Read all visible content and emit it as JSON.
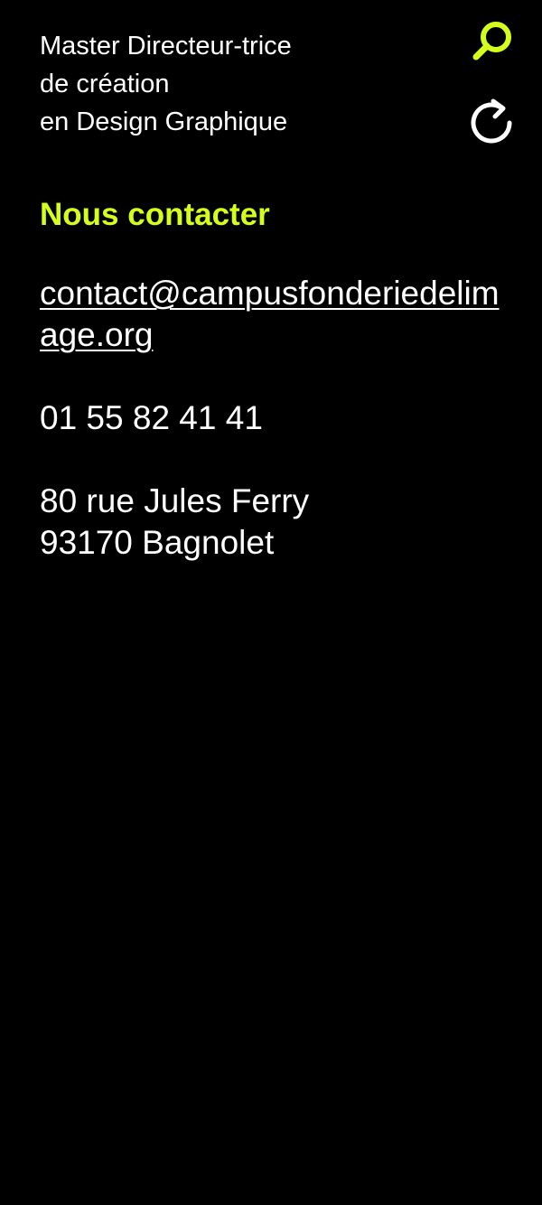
{
  "colors": {
    "background": "#000000",
    "text": "#ffffff",
    "accent": "#d4ff1a"
  },
  "header": {
    "title_lines": [
      "Master Directeur-trice",
      "de création",
      "en Design Graphique"
    ],
    "search_icon": "search-icon",
    "refresh_icon": "refresh-icon"
  },
  "contact": {
    "heading": "Nous contacter",
    "email": "contact@campusfonderiedelimage.org",
    "phone": "01 55 82 41 41",
    "address_lines": [
      "80 rue Jules Ferry",
      "93170 Bagnolet"
    ]
  }
}
